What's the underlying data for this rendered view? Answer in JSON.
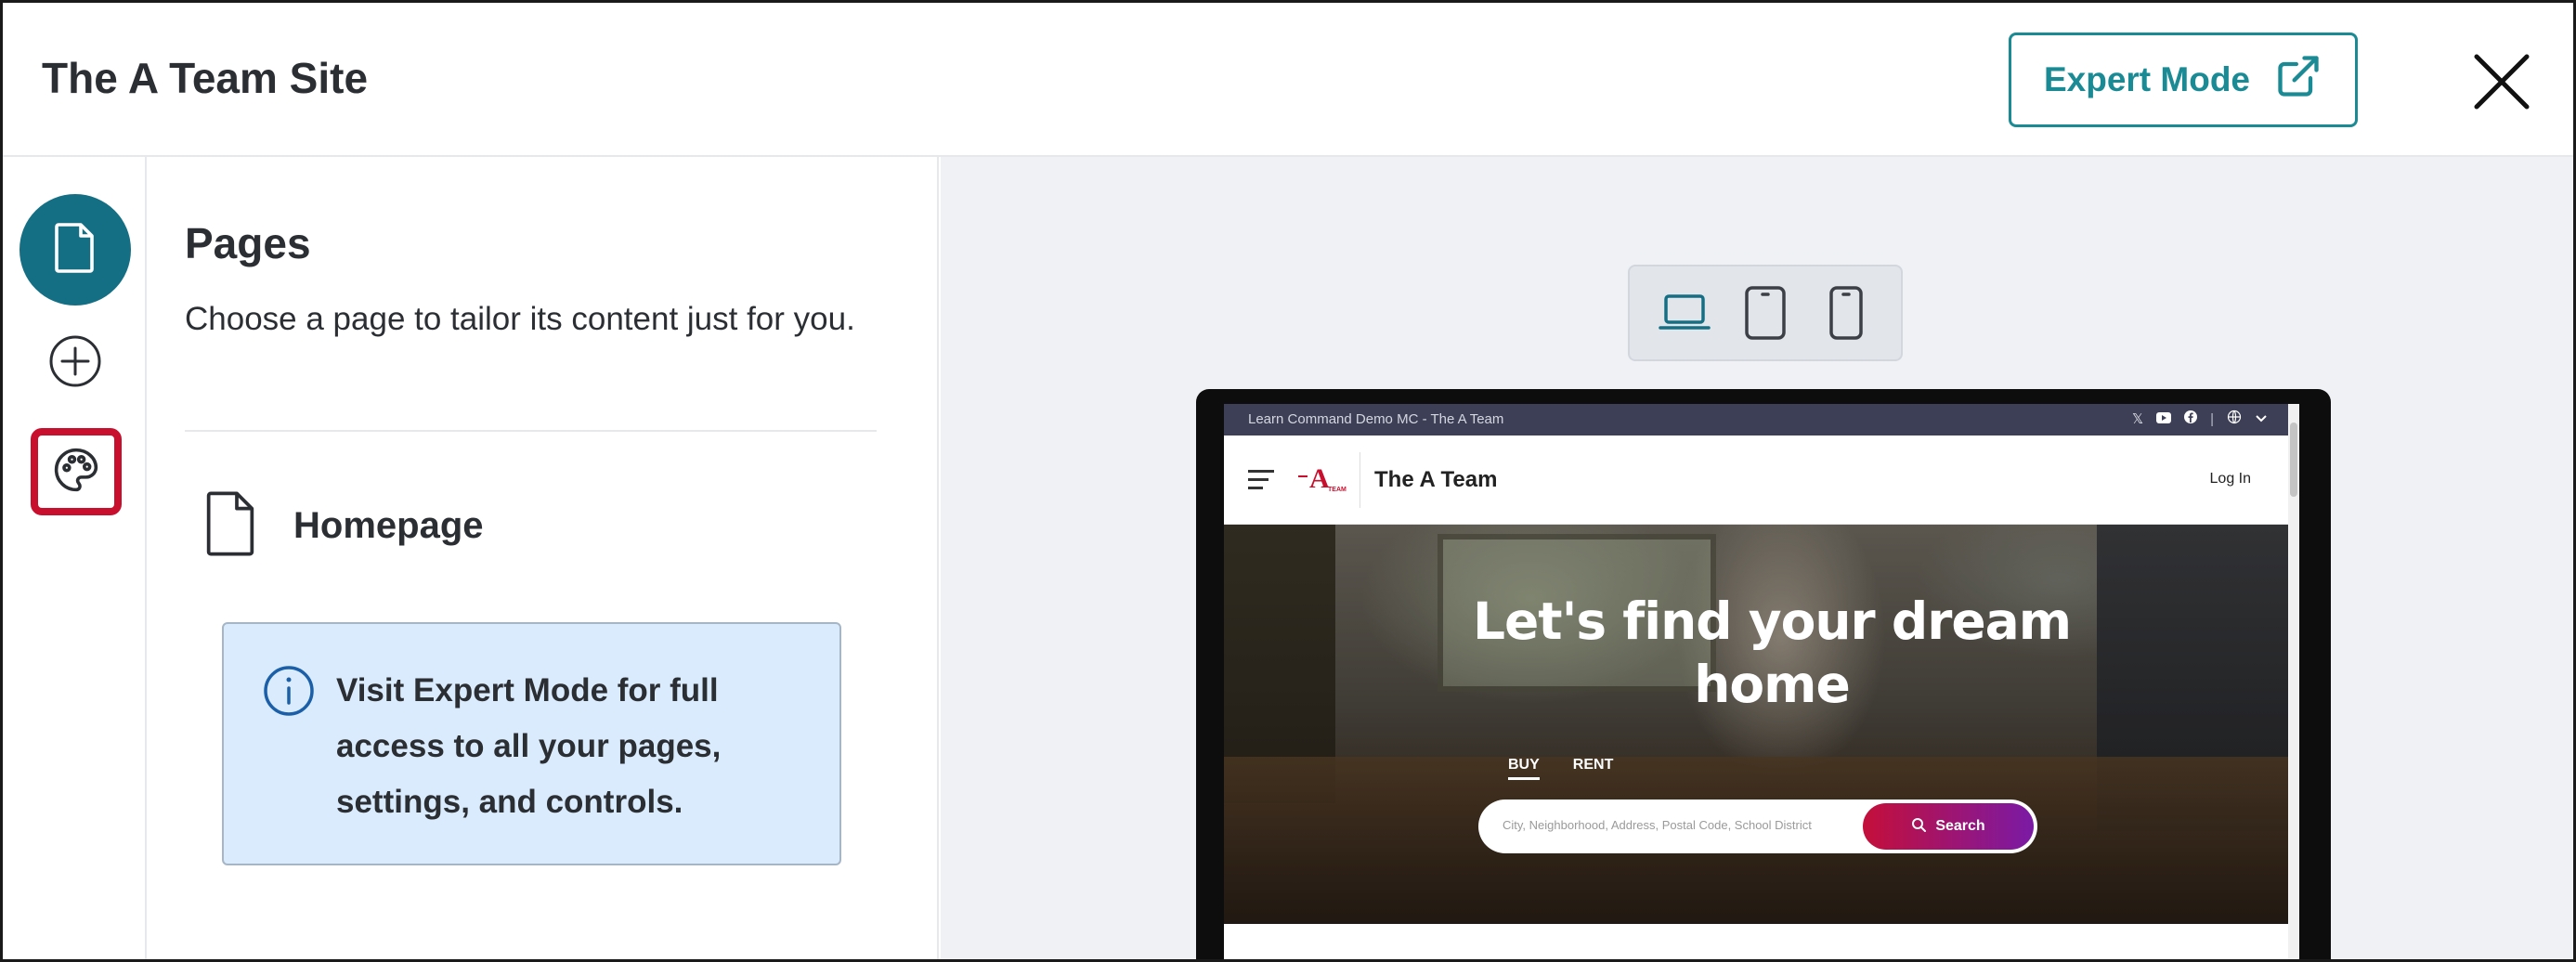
{
  "header": {
    "title": "The A Team Site",
    "expert_mode_label": "Expert Mode"
  },
  "panel": {
    "title": "Pages",
    "description": "Choose a page to tailor its content just for you.",
    "page_item": "Homepage",
    "info_text": "Visit Expert Mode for full access to all your pages, settings, and controls."
  },
  "preview": {
    "topbar_text": "Learn Command Demo MC - The A Team",
    "topbar_icons": [
      "x-icon",
      "youtube-icon",
      "facebook-icon",
      "globe-icon"
    ],
    "brand": "The A Team",
    "logo_text": "A",
    "logo_small": "TEAM",
    "login": "Log In",
    "hero_title": "Let's find your dream home",
    "tab_buy": "BUY",
    "tab_rent": "RENT",
    "search_placeholder": "City, Neighborhood, Address, Postal Code, School District",
    "search_button": "Search"
  },
  "colors": {
    "accent": "#1a8a95",
    "rail_active": "#146f84",
    "highlight": "#c8102e",
    "info_bg": "#d9ebfc"
  }
}
